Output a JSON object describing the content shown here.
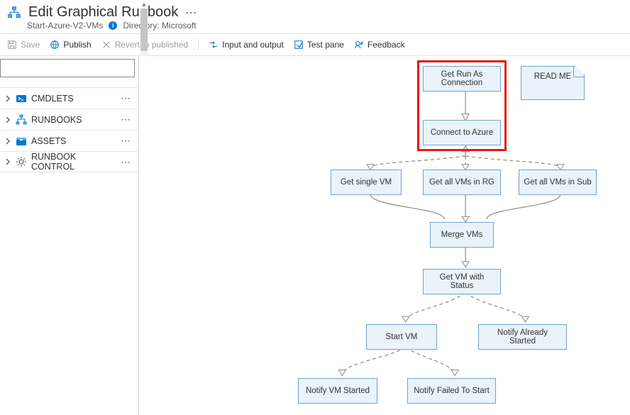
{
  "header": {
    "title": "Edit Graphical Runbook",
    "subtitle_name": "Start-Azure-V2-VMs",
    "directory_label": "Directory: Microsoft"
  },
  "toolbar": {
    "save": "Save",
    "publish": "Publish",
    "revert": "Revert to published",
    "io": "Input and output",
    "test": "Test pane",
    "feedback": "Feedback"
  },
  "sidebar": {
    "search_placeholder": "",
    "items": [
      {
        "label": "CMDLETS",
        "icon": "ps-icon"
      },
      {
        "label": "RUNBOOKS",
        "icon": "runbook-icon"
      },
      {
        "label": "ASSETS",
        "icon": "assets-icon"
      },
      {
        "label": "RUNBOOK CONTROL",
        "icon": "gear-icon"
      }
    ]
  },
  "nodes": {
    "getRunAs": "Get Run As Connection",
    "connectAzure": "Connect to Azure",
    "readme": "READ ME",
    "getSingleVM": "Get single VM",
    "getAllRG": "Get all VMs in RG",
    "getAllSub": "Get all VMs in Sub",
    "mergeVMs": "Merge VMs",
    "getStatus": "Get VM with Status",
    "startVM": "Start VM",
    "notifyAlready": "Notify Already Started",
    "notifyStarted": "Notify VM Started",
    "notifyFailed": "Notify Failed To Start"
  }
}
